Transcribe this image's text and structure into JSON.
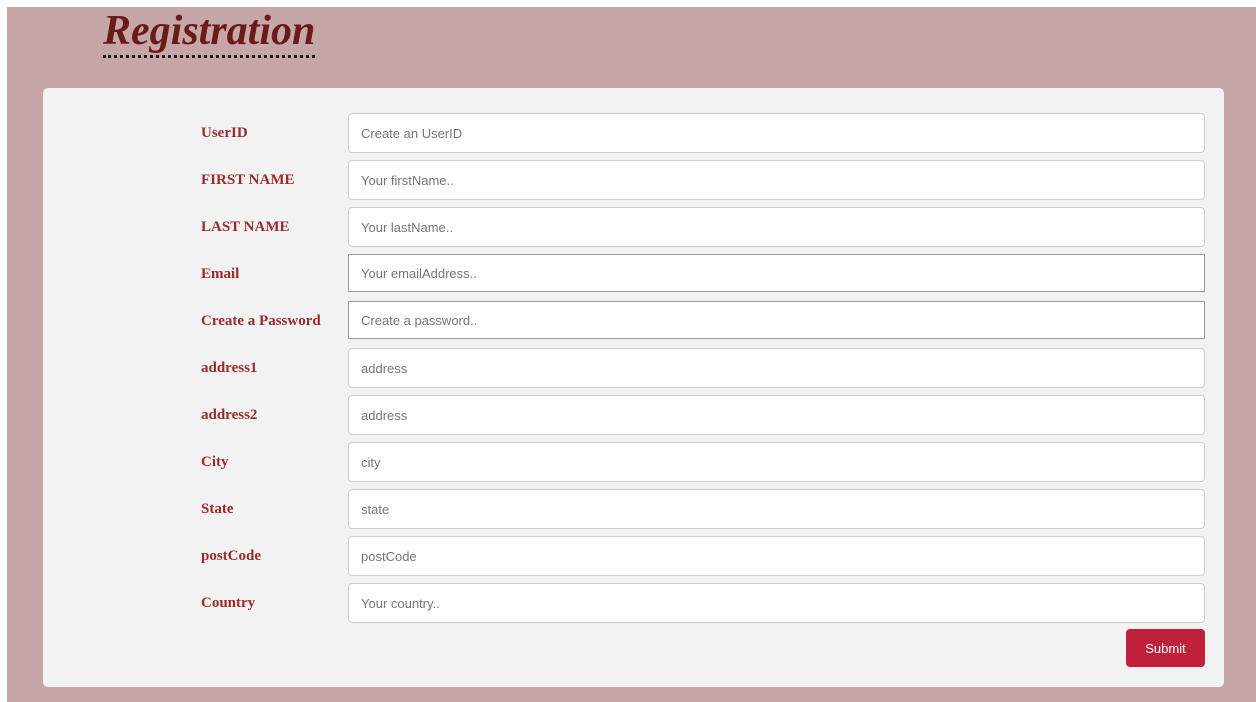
{
  "page": {
    "title": "Registration"
  },
  "form": {
    "fields": [
      {
        "label": "UserID",
        "placeholder": "Create an UserID",
        "value": ""
      },
      {
        "label": "FIRST NAME",
        "placeholder": "Your firstName..",
        "value": ""
      },
      {
        "label": "LAST NAME",
        "placeholder": "Your lastName..",
        "value": ""
      },
      {
        "label": "Email",
        "placeholder": "Your emailAddress..",
        "value": ""
      },
      {
        "label": "Create a Password",
        "placeholder": "Create a password..",
        "value": ""
      },
      {
        "label": "address1",
        "placeholder": "address",
        "value": ""
      },
      {
        "label": "address2",
        "placeholder": "address",
        "value": ""
      },
      {
        "label": "City",
        "placeholder": "city",
        "value": ""
      },
      {
        "label": "State",
        "placeholder": "state",
        "value": ""
      },
      {
        "label": "postCode",
        "placeholder": "postCode",
        "value": ""
      },
      {
        "label": "Country",
        "placeholder": "Your country..",
        "value": ""
      }
    ],
    "submit_label": "Submit"
  },
  "colors": {
    "background": "#c6a6a6",
    "card": "#f2f2f2",
    "title": "#6b1a1a",
    "label": "#9b2a2a",
    "submit": "#c0203a"
  }
}
